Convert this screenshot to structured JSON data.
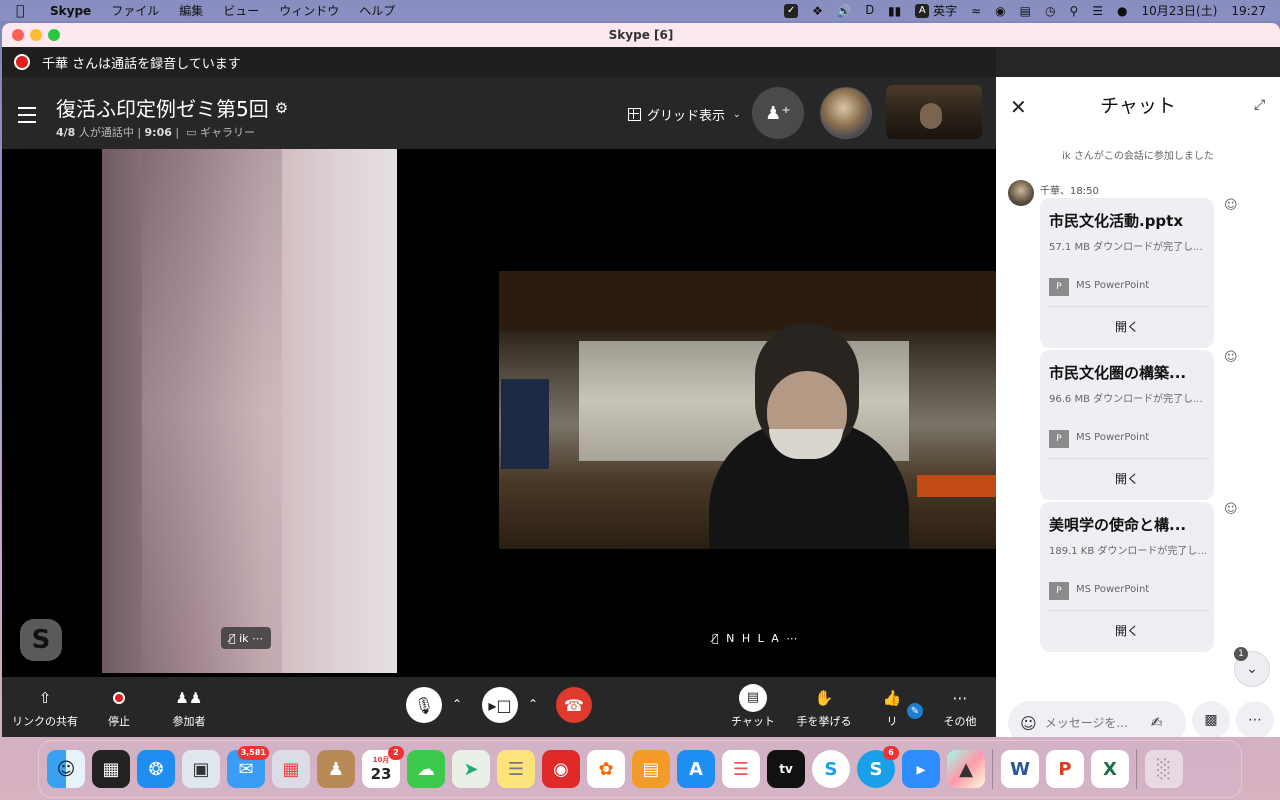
{
  "menubar": {
    "app": "Skype",
    "menus": [
      "ファイル",
      "編集",
      "ビュー",
      "ウィンドウ",
      "ヘルプ"
    ],
    "ime": "英字",
    "date": "10月23日(土)",
    "time": "19:27"
  },
  "window": {
    "title": "Skype [6]"
  },
  "recording": {
    "text": "千華 さんは通話を録音しています"
  },
  "header": {
    "meeting_title": "復活ふ印定例ゼミ第5回",
    "participants": "4/8",
    "participants_suffix": " 人が通話中 | ",
    "duration": "9:06",
    "duration_sep": " | ",
    "view": "ギャラリー",
    "grid_label": "グリッド表示"
  },
  "tiles": [
    {
      "name": "ik"
    },
    {
      "name": "N H L A"
    }
  ],
  "controls": {
    "share": "リンクの共有",
    "stop": "停止",
    "participants": "参加者",
    "chat": "チャット",
    "raise_hand": "手を挙げる",
    "react": "リ",
    "more": "その他"
  },
  "chat": {
    "title": "チャット",
    "system": "ik さんがこの会話に参加しました",
    "sender": "千華、18:50",
    "files": [
      {
        "name": "市民文化活動.pptx",
        "size": "57.1 MB ダウンロードが完了し...",
        "app": "MS PowerPoint",
        "action": "開く"
      },
      {
        "name": "市民文化圏の構築...",
        "size": "96.6 MB ダウンロードが完了し...",
        "app": "MS PowerPoint",
        "action": "開く"
      },
      {
        "name": "美唄学の使命と構...",
        "size": "189.1 KB ダウンロードが完了し...",
        "app": "MS PowerPoint",
        "action": "開く"
      }
    ],
    "unread": "1",
    "placeholder": "メッセージを..."
  },
  "dock": {
    "badges": {
      "mail": "3,581",
      "calendar": "2",
      "skype": "6"
    },
    "calendar_month": "10月",
    "calendar_day": "23",
    "tv_label": "tv"
  },
  "colors": {
    "record": "#e02020",
    "hangup": "#e03a2f",
    "react_badge": "#1e7fd0",
    "chat_bg": "#ffffff"
  }
}
